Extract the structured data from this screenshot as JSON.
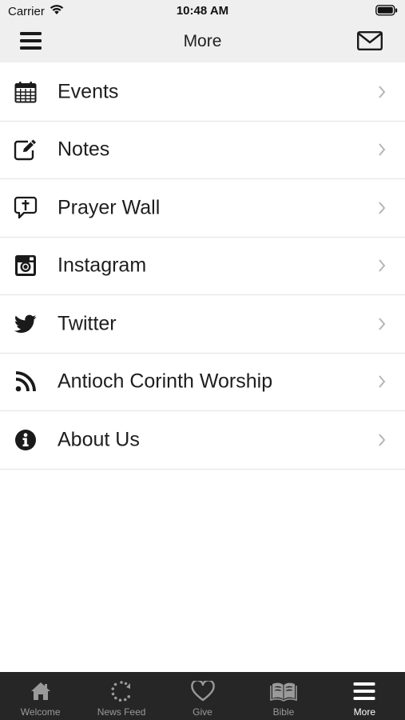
{
  "status_bar": {
    "carrier": "Carrier",
    "time": "10:48 AM",
    "wifi_icon": "wifi-icon",
    "battery_icon": "battery-icon"
  },
  "nav": {
    "title": "More",
    "menu_icon": "hamburger-icon",
    "mail_icon": "envelope-icon"
  },
  "menu": {
    "items": [
      {
        "label": "Events",
        "icon": "calendar-icon"
      },
      {
        "label": "Notes",
        "icon": "edit-icon"
      },
      {
        "label": "Prayer Wall",
        "icon": "prayer-bubble-icon"
      },
      {
        "label": "Instagram",
        "icon": "instagram-icon"
      },
      {
        "label": "Twitter",
        "icon": "twitter-icon"
      },
      {
        "label": "Antioch Corinth Worship",
        "icon": "rss-icon"
      },
      {
        "label": "About Us",
        "icon": "info-icon"
      }
    ]
  },
  "tabs": [
    {
      "label": "Welcome",
      "icon": "home-icon",
      "active": false
    },
    {
      "label": "News Feed",
      "icon": "refresh-icon",
      "active": false
    },
    {
      "label": "Give",
      "icon": "heart-icon",
      "active": false
    },
    {
      "label": "Bible",
      "icon": "book-icon",
      "active": false
    },
    {
      "label": "More",
      "icon": "hamburger-icon",
      "active": true
    }
  ],
  "colors": {
    "bar_background": "#efefef",
    "tab_bar_background": "#262626",
    "tab_active": "#ffffff",
    "tab_inactive": "#9a9a9a"
  }
}
